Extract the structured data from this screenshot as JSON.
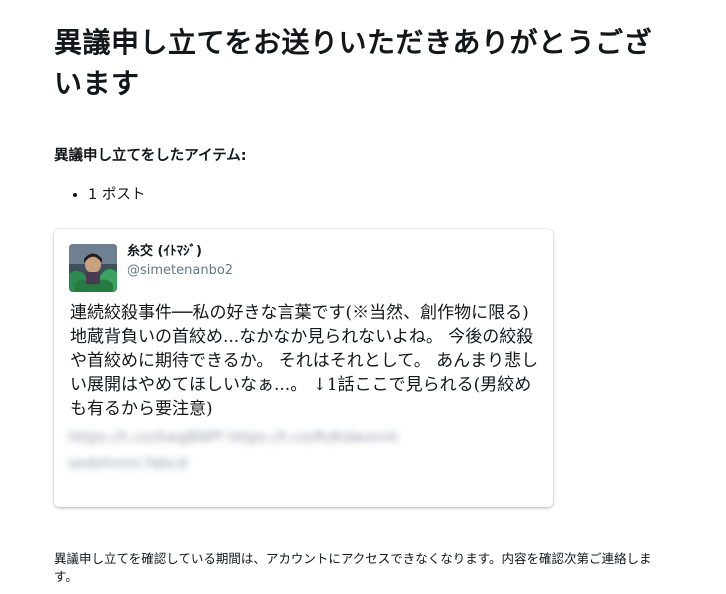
{
  "page": {
    "title": "異議申し立てをお送りいただきありがとうございます"
  },
  "appeal": {
    "items_label": "異議申し立てをしたアイテム:",
    "items": [
      "1 ポスト"
    ]
  },
  "tweet": {
    "display_name": "糸交 (ｲﾄﾏｼﾞ)",
    "handle": "@simetenanbo2",
    "avatar": "user-avatar-icon",
    "text": "連続絞殺事件──私の好きな言葉です(※当然、創作物に限る) 地蔵背負いの首絞め...なかなか見られないよね。 今後の絞殺や首絞めに期待できるか。 それはそれとして。 あんまり悲しい展開はやめてほしいなぁ...。 ↓1話ここで見られる(男絞めも有るから要注意)",
    "blurred_link_1": "https://t.co/XwgBNPf https://t.co/RzKdwxnnt",
    "blurred_link_2": "sedehnini.fabcd"
  },
  "footer": {
    "notice": "異議申し立てを確認している期間は、アカウントにアクセスできなくなります。内容を確認次第ご連絡します。"
  }
}
